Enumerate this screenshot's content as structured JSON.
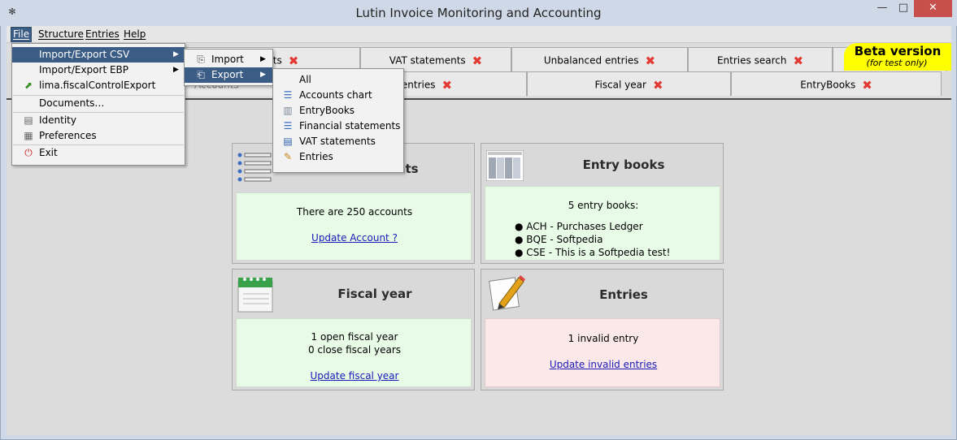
{
  "window": {
    "title": "Lutin Invoice Monitoring and Accounting",
    "controls": {
      "minimize": "—",
      "maximize": "□",
      "close": "✕"
    }
  },
  "menubar": {
    "file": "File",
    "structure": "Structure",
    "entries": "Entries",
    "help": "Help"
  },
  "file_menu": {
    "items": [
      {
        "label": "Import/Export CSV",
        "icon": "none",
        "submenu": true
      },
      {
        "label": "Import/Export EBP",
        "icon": "none",
        "submenu": true
      },
      {
        "label": "lima.fiscalControlExport",
        "icon": "export-icon",
        "submenu": false
      },
      {
        "label": "Documents…",
        "icon": "none",
        "submenu": false
      },
      {
        "label": "Identity",
        "icon": "identity-icon",
        "submenu": false
      },
      {
        "label": "Preferences",
        "icon": "preferences-icon",
        "submenu": false
      },
      {
        "label": "Exit",
        "icon": "exit-icon",
        "submenu": false
      }
    ]
  },
  "csv_submenu": {
    "import": "Import",
    "export": "Export"
  },
  "export_submenu": {
    "items": [
      "All",
      "Accounts chart",
      "EntryBooks",
      "Financial statements",
      "VAT statements",
      "Entries"
    ]
  },
  "tabs": {
    "row1": [
      "ements",
      "VAT statements",
      "Unbalanced entries",
      "Entries search"
    ],
    "row2": [
      "Accounts",
      "entries",
      "Fiscal year",
      "EntryBooks"
    ]
  },
  "beta": {
    "title": "Beta version",
    "subtitle": "(for test only)",
    "color": "#ffff00"
  },
  "panels": {
    "accounts": {
      "title": "Accounts",
      "text": "There are 250 accounts",
      "link": "Update Account ?"
    },
    "entrybooks": {
      "title": "Entry books",
      "header": "5 entry books:",
      "items": [
        "ACH - Purchases Ledger",
        "BQE - Softpedia",
        "CSE - This is a Softpedia test!"
      ]
    },
    "fiscal": {
      "title": "Fiscal year",
      "line1": "1 open fiscal year",
      "line2": "0 close fiscal years",
      "link": "Update fiscal year"
    },
    "entries": {
      "title": "Entries",
      "text": "1 invalid entry",
      "link": "Update invalid entries"
    }
  },
  "colors": {
    "highlight": "#3b5c84",
    "green_panel": "#e7fbe7",
    "red_panel": "#fbe9e9",
    "close_x": "#e23a33"
  }
}
